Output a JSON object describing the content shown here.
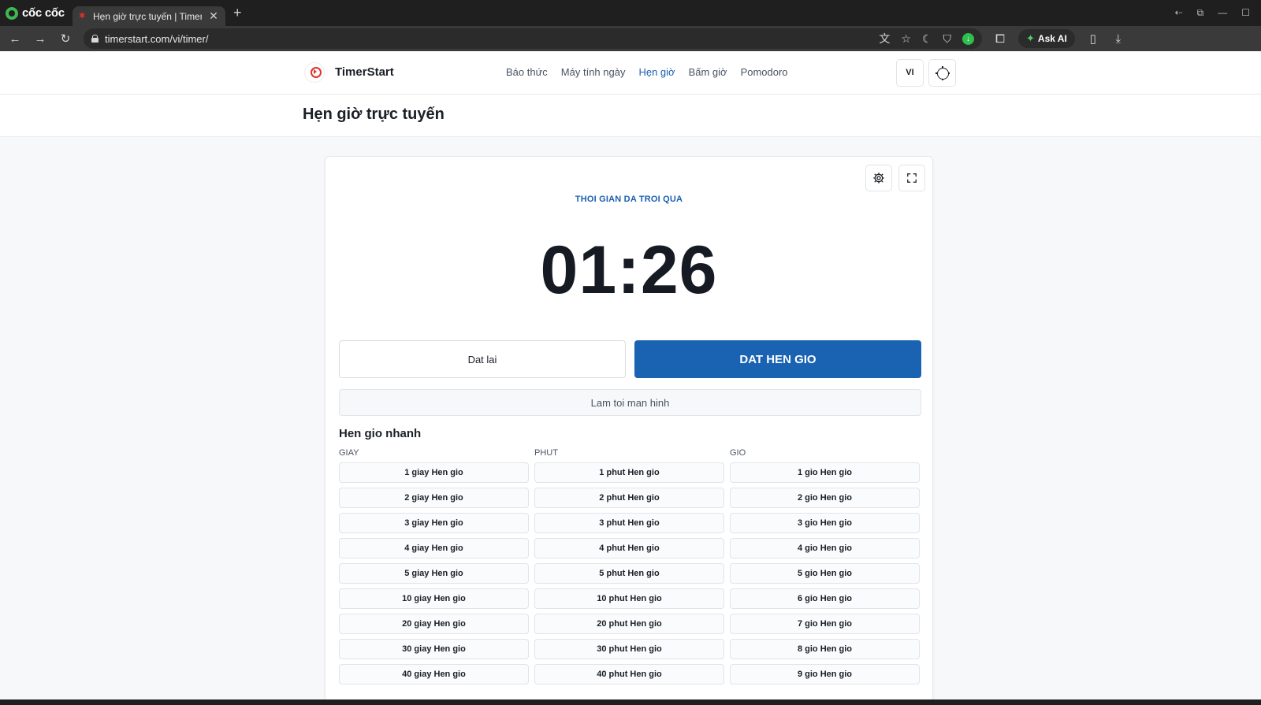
{
  "browser": {
    "brand": "cốc cốc",
    "tab_title": "Hẹn giờ trực tuyến | TimerS",
    "url": "timerstart.com/vi/timer/",
    "ask_ai": "Ask AI"
  },
  "site": {
    "name": "TimerStart",
    "nav": [
      "Báo thức",
      "Máy tính ngày",
      "Hẹn giờ",
      "Bấm giờ",
      "Pomodoro"
    ],
    "active_nav": "Hẹn giờ",
    "lang": "VI"
  },
  "page_title": "Hẹn giờ trực tuyến",
  "timer": {
    "label": "THOI GIAN DA TROI QUA",
    "display": "01:26",
    "reset": "Dat lai",
    "start": "DAT HEN GIO",
    "dim": "Lam toi man hinh"
  },
  "quick": {
    "title": "Hen gio nhanh",
    "columns": [
      {
        "header": "GIAY",
        "items": [
          "1 giay Hen gio",
          "2 giay Hen gio",
          "3 giay Hen gio",
          "4 giay Hen gio",
          "5 giay Hen gio",
          "10 giay Hen gio",
          "20 giay Hen gio",
          "30 giay Hen gio",
          "40 giay Hen gio"
        ]
      },
      {
        "header": "PHUT",
        "items": [
          "1 phut Hen gio",
          "2 phut Hen gio",
          "3 phut Hen gio",
          "4 phut Hen gio",
          "5 phut Hen gio",
          "10 phut Hen gio",
          "20 phut Hen gio",
          "30 phut Hen gio",
          "40 phut Hen gio"
        ]
      },
      {
        "header": "GIO",
        "items": [
          "1 gio Hen gio",
          "2 gio Hen gio",
          "3 gio Hen gio",
          "4 gio Hen gio",
          "5 gio Hen gio",
          "6 gio Hen gio",
          "7 gio Hen gio",
          "8 gio Hen gio",
          "9 gio Hen gio"
        ]
      }
    ]
  },
  "colors": {
    "accent": "#1a63b3",
    "label_blue": "#1a5fb0",
    "text_dark": "#161a22"
  }
}
